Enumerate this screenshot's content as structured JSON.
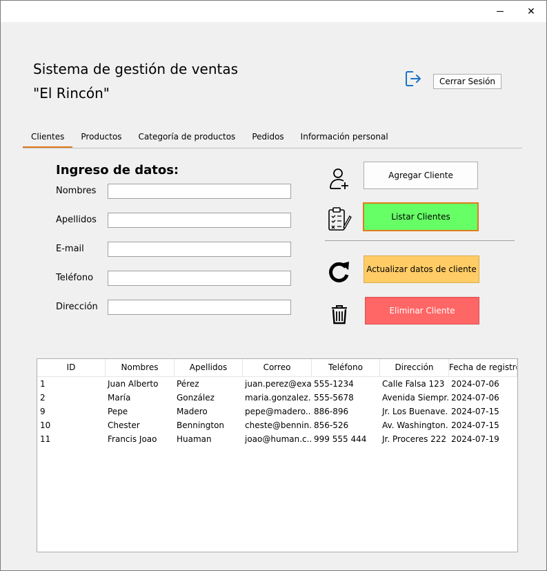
{
  "window": {
    "minimize_icon": "minimize-icon",
    "close_icon": "close-icon",
    "close_glyph": "✕"
  },
  "header": {
    "title_line1": "Sistema de gestión de ventas",
    "title_line2": "\"El Rincón\"",
    "logout_icon": "logout-icon",
    "logout_label": "Cerrar Sesión"
  },
  "tabs": [
    {
      "label": "Clientes",
      "active": true
    },
    {
      "label": "Productos",
      "active": false
    },
    {
      "label": "Categoría de productos",
      "active": false
    },
    {
      "label": "Pedidos",
      "active": false
    },
    {
      "label": "Información personal",
      "active": false
    }
  ],
  "form": {
    "heading": "Ingreso de datos:",
    "fields": [
      {
        "label": "Nombres",
        "value": "",
        "placeholder": ""
      },
      {
        "label": "Apellidos",
        "value": "",
        "placeholder": ""
      },
      {
        "label": "E-mail",
        "value": "",
        "placeholder": ""
      },
      {
        "label": "Teléfono",
        "value": "",
        "placeholder": ""
      },
      {
        "label": "Dirección",
        "value": "",
        "placeholder": ""
      }
    ]
  },
  "actions": {
    "add": {
      "label": "Agregar Cliente",
      "icon": "add-user-icon"
    },
    "list": {
      "label": "Listar Clientes",
      "icon": "clipboard-checklist-icon",
      "color": "#66ff66",
      "border": "#e07b1a"
    },
    "update": {
      "label": "Actualizar datos de cliente",
      "icon": "refresh-icon",
      "color": "#ffcc66"
    },
    "delete": {
      "label": "Eliminar Cliente",
      "icon": "trash-icon",
      "color": "#ff6666"
    }
  },
  "table": {
    "columns": [
      "ID",
      "Nombres",
      "Apellidos",
      "Correo",
      "Teléfono",
      "Dirección",
      "Fecha de registro"
    ],
    "rows": [
      [
        "1",
        "Juan Alberto",
        "Pérez",
        "juan.perez@exa...",
        "555-1234",
        "Calle Falsa 123",
        "2024-07-06"
      ],
      [
        "2",
        "María",
        "González",
        "maria.gonzalez...",
        "555-5678",
        "Avenida Siempr...",
        "2024-07-06"
      ],
      [
        "9",
        "Pepe",
        "Madero",
        "pepe@madero....",
        "886-896",
        "Jr. Los Buenave...",
        "2024-07-15"
      ],
      [
        "10",
        "Chester",
        "Bennington",
        "cheste@bennin...",
        "856-526",
        "Av. Washington...",
        "2024-07-15"
      ],
      [
        "11",
        "Francis Joao",
        "Huaman",
        "joao@human.c...",
        "999 555 444",
        "Jr. Proceres 222",
        "2024-07-19"
      ]
    ]
  },
  "colors": {
    "accent": "#e07b1a",
    "list_button": "#66ff66",
    "update_button": "#ffcc66",
    "delete_button": "#ff6666"
  }
}
